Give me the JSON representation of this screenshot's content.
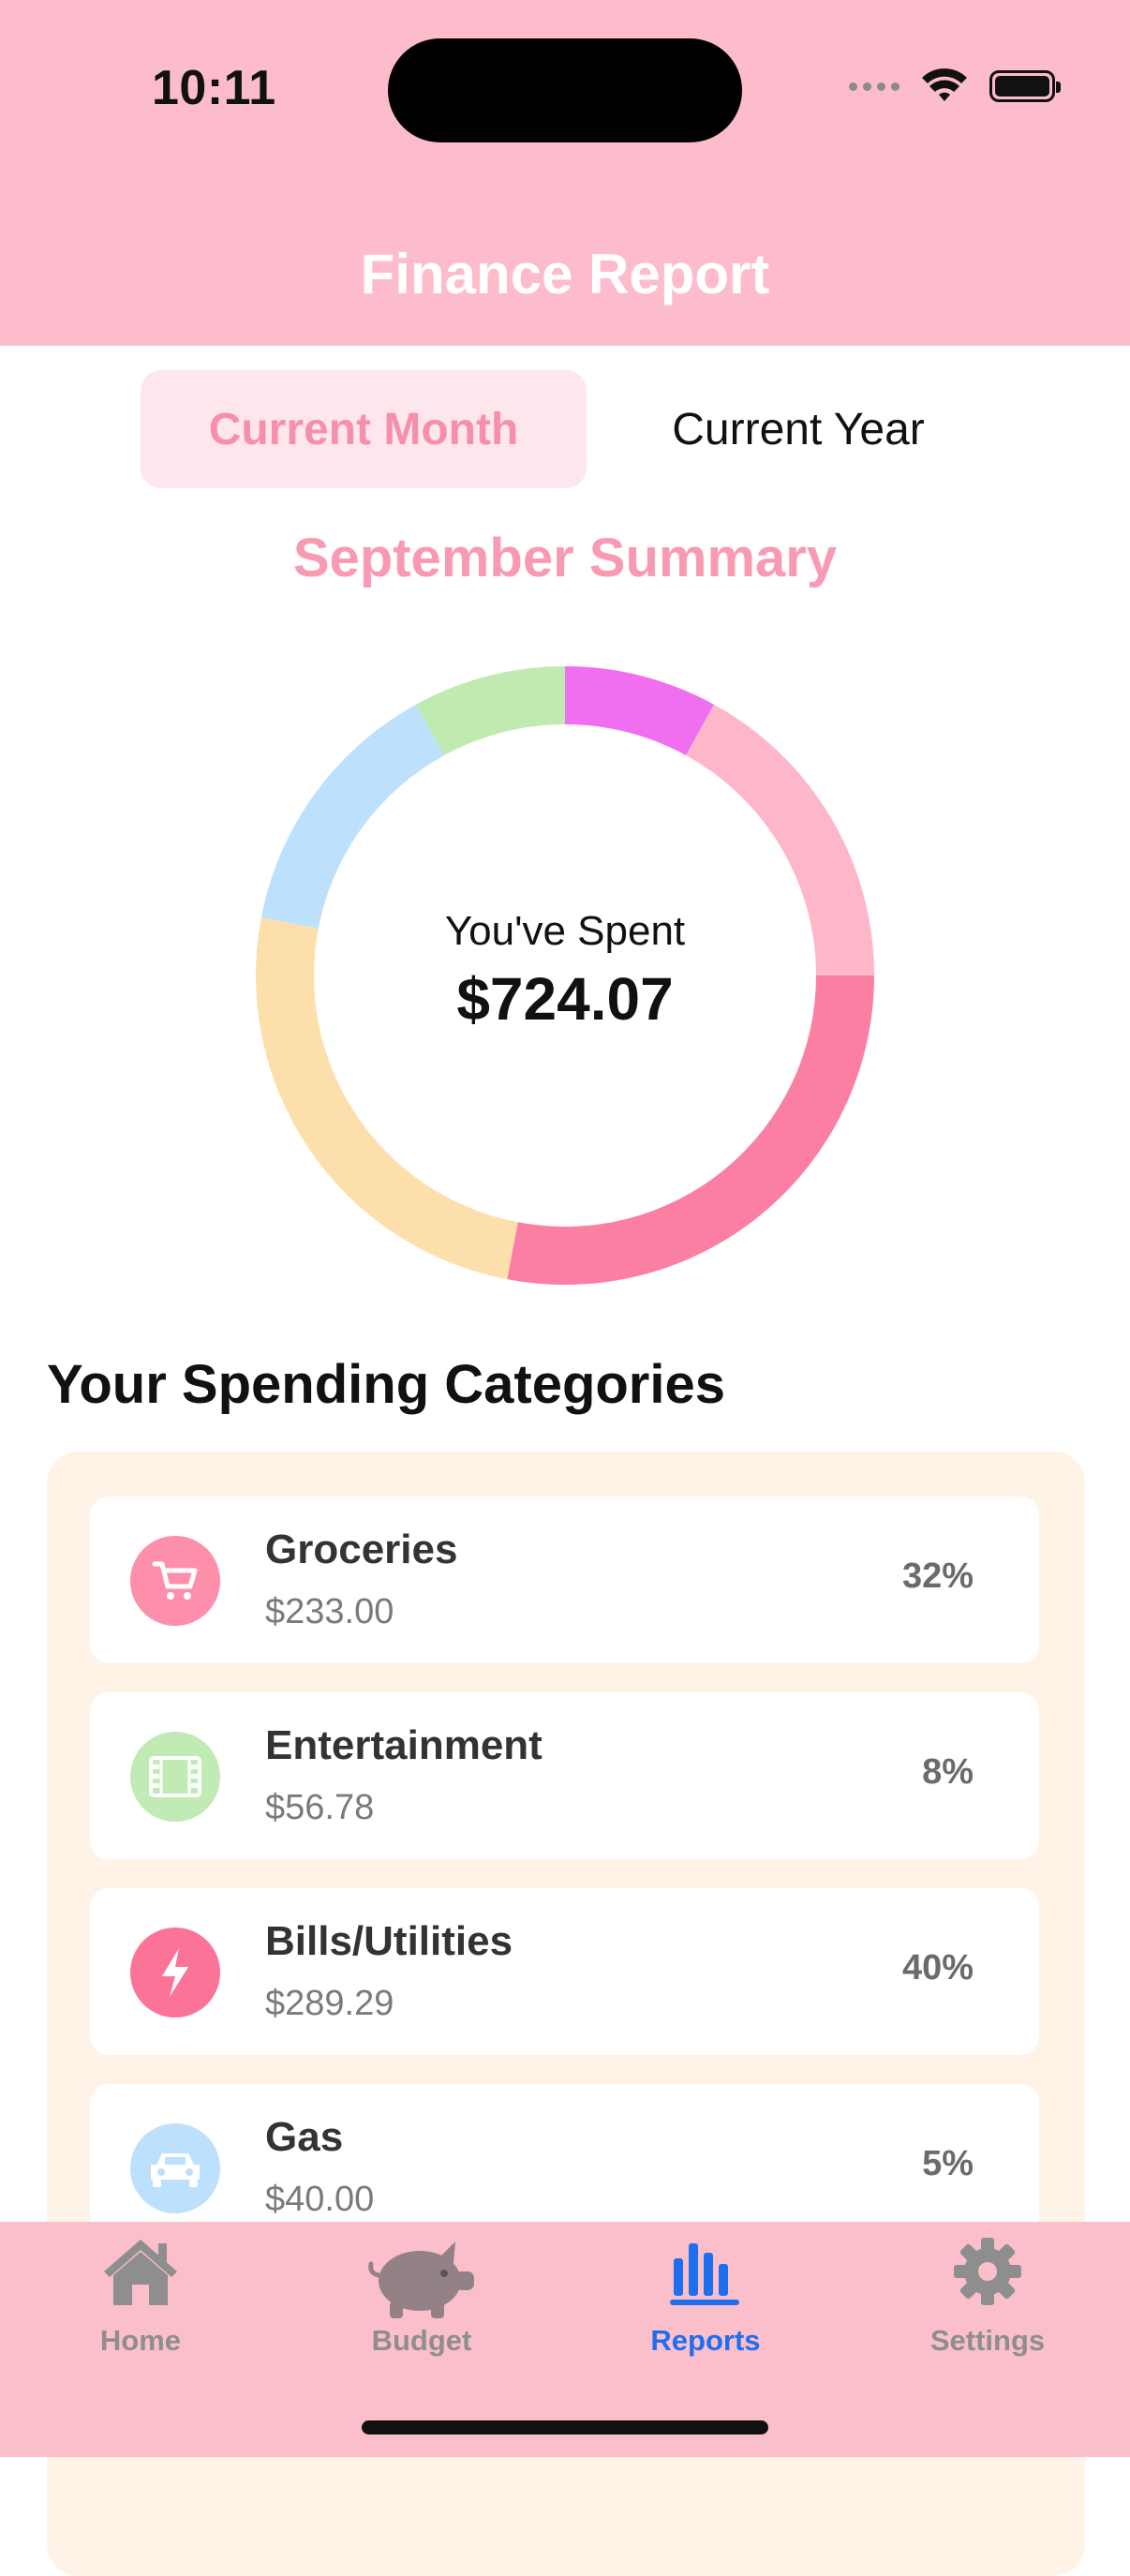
{
  "status_bar": {
    "time": "10:11"
  },
  "header": {
    "title": "Finance Report"
  },
  "period_toggle": {
    "current_month": "Current Month",
    "current_year": "Current Year",
    "selected": "Current Month"
  },
  "summary": {
    "title": "September Summary",
    "spent_label": "You've Spent",
    "spent_amount": "$724.07"
  },
  "donut_segments": [
    {
      "label": "Entertainment",
      "color": "#f06ff0",
      "fraction": 0.08
    },
    {
      "label": "Light pink",
      "color": "#feb6c9",
      "fraction": 0.17
    },
    {
      "label": "Bills/Utilities",
      "color": "#fb7fa3",
      "fraction": 0.28
    },
    {
      "label": "Gas",
      "color": "#fddfab",
      "fraction": 0.25
    },
    {
      "label": "Blue",
      "color": "#bde0fd",
      "fraction": 0.14
    },
    {
      "label": "Green",
      "color": "#c0eab0",
      "fraction": 0.08
    }
  ],
  "categories_section": {
    "title": "Your Spending Categories"
  },
  "categories": [
    {
      "name": "Groceries",
      "amount": "$233.00",
      "percent": "32%",
      "icon": "cart-icon",
      "color": "#fe8fab"
    },
    {
      "name": "Entertainment",
      "amount": "$56.78",
      "percent": "8%",
      "icon": "film-icon",
      "color": "#c1ebb4"
    },
    {
      "name": "Bills/Utilities",
      "amount": "$289.29",
      "percent": "40%",
      "icon": "bolt-icon",
      "color": "#fb7397"
    },
    {
      "name": "Gas",
      "amount": "$40.00",
      "percent": "5%",
      "icon": "car-icon",
      "color": "#bde0fd"
    }
  ],
  "tabs": [
    {
      "label": "Home",
      "icon": "house-icon"
    },
    {
      "label": "Budget",
      "icon": "piggy-bank-icon"
    },
    {
      "label": "Reports",
      "icon": "bar-chart-icon"
    },
    {
      "label": "Settings",
      "icon": "gear-icon"
    }
  ],
  "active_tab": "Reports"
}
